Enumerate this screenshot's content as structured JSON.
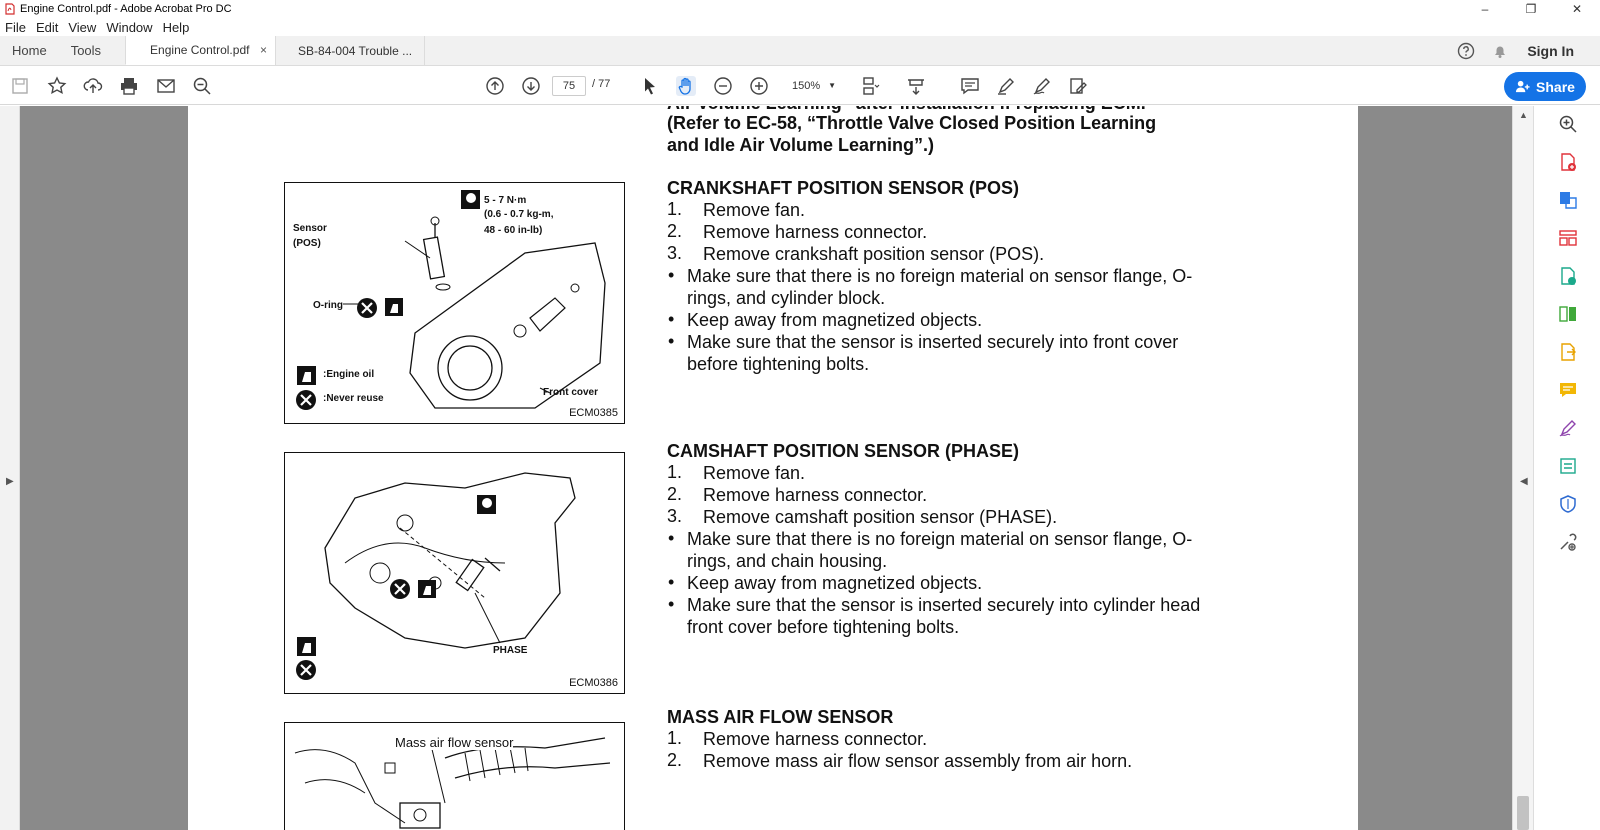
{
  "window": {
    "title": "Engine Control.pdf - Adobe Acrobat Pro DC",
    "controls": [
      "–",
      "❐",
      "✕"
    ]
  },
  "menu": [
    "File",
    "Edit",
    "View",
    "Window",
    "Help"
  ],
  "tabs": {
    "home": "Home",
    "tools": "Tools",
    "docs": [
      {
        "label": "Engine Control.pdf",
        "close": "×"
      },
      {
        "label": "SB-84-004 Trouble ..."
      }
    ],
    "sign_in": "Sign In"
  },
  "toolbar": {
    "page_current": "75",
    "page_total": "/ 77",
    "zoom": "150%",
    "share": "Share"
  },
  "document": {
    "intro_top": "Air Volume Learning” after installation if replacing ECM.",
    "intro_line1": "(Refer to EC-58, “Throttle Valve Closed Position Learning",
    "intro_line2": "and Idle Air Volume Learning”.)",
    "sections": [
      {
        "heading": "CRANKSHAFT POSITION SENSOR (POS)",
        "steps": [
          "Remove fan.",
          "Remove harness connector.",
          "Remove crankshaft position sensor (POS)."
        ],
        "bullets": [
          [
            "Make sure that there is no foreign material on sensor flange, O-",
            "rings, and cylinder block."
          ],
          [
            "Keep away from magnetized objects."
          ],
          [
            "Make sure that the sensor is inserted securely into front cover",
            "before tightening bolts."
          ]
        ],
        "figure": {
          "code": "ECM0385",
          "torque": [
            "5 - 7 N·m",
            "(0.6 - 0.7 kg-m,",
            "48 - 60 in-lb)"
          ],
          "sensor_label": [
            "Sensor",
            "(POS)"
          ],
          "oring": "O-ring",
          "legend": [
            ":Engine oil",
            ":Never reuse"
          ],
          "cover": "Front cover"
        }
      },
      {
        "heading": "CAMSHAFT POSITION SENSOR (PHASE)",
        "steps": [
          "Remove fan.",
          "Remove harness connector.",
          "Remove camshaft position sensor (PHASE)."
        ],
        "bullets": [
          [
            "Make sure that there is no foreign material on sensor flange, O-",
            "rings, and chain housing."
          ],
          [
            "Keep away from magnetized objects."
          ],
          [
            "Make sure that the sensor is inserted securely into cylinder head",
            "front cover before tightening bolts."
          ]
        ],
        "figure": {
          "code": "ECM0386",
          "sensor_label": "PHASE"
        }
      },
      {
        "heading": "MASS AIR FLOW SENSOR",
        "steps": [
          "Remove harness connector.",
          "Remove mass air flow sensor assembly from air horn."
        ],
        "figure": {
          "label": "Mass air flow sensor"
        }
      }
    ]
  },
  "colors": {
    "accent": "#1473e6",
    "pdf_red": "#d32f2f"
  }
}
